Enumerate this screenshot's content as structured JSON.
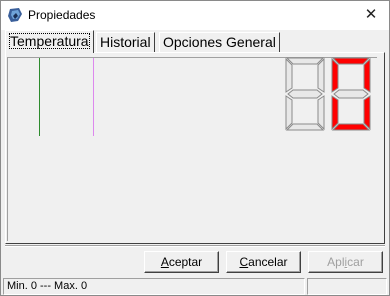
{
  "window": {
    "title": "Propiedades",
    "close_glyph": "✕",
    "icon": "app-icon"
  },
  "tabs": [
    {
      "label": "Temperatura",
      "active": true
    },
    {
      "label": "Historial",
      "active": false
    },
    {
      "label": "Opciones General",
      "active": false
    }
  ],
  "display": {
    "digit1_active": false,
    "digit2_value": "0",
    "segment_off_color": "#e8e8e8",
    "segment_on_color": "#ff0000",
    "line_colors": [
      "#2e8b2e",
      "#dd88ee"
    ]
  },
  "buttons": {
    "accept": {
      "prefix": "",
      "underline": "A",
      "rest": "ceptar"
    },
    "cancel": {
      "prefix": "",
      "underline": "C",
      "rest": "ancelar"
    },
    "apply": {
      "prefix": "Apl",
      "underline": "i",
      "rest": "car"
    }
  },
  "status": {
    "text": "Min.  0 --- Max.  0",
    "panel2": ""
  }
}
